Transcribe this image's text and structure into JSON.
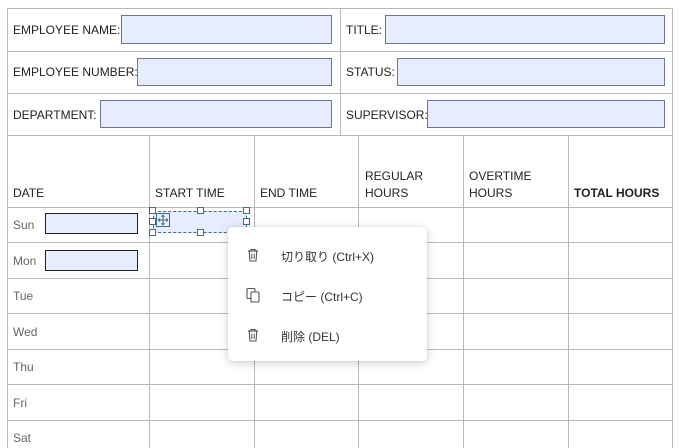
{
  "form": {
    "employee_name_label": "EMPLOYEE NAME:",
    "title_label": "TITLE:",
    "employee_number_label": "EMPLOYEE NUMBER:",
    "status_label": "STATUS:",
    "department_label": "DEPARTMENT:",
    "supervisor_label": "SUPERVISOR:",
    "employee_name_value": "",
    "title_value": "",
    "employee_number_value": "",
    "status_value": "",
    "department_value": "",
    "supervisor_value": ""
  },
  "table": {
    "headers": {
      "date": "DATE",
      "start_time": "START TIME",
      "end_time": "END TIME",
      "regular_hours_1": "REGULAR",
      "regular_hours_2": "HOURS",
      "overtime_hours_1": "OVERTIME",
      "overtime_hours_2": "HOURS",
      "total_hours": "TOTAL HOURS"
    },
    "days": [
      "Sun",
      "Mon",
      "Tue",
      "Wed",
      "Thu",
      "Fri",
      "Sat"
    ]
  },
  "context_menu": {
    "items": [
      {
        "label": "切り取り (Ctrl+X)",
        "icon": "trash-icon"
      },
      {
        "label": "コピー (Ctrl+C)",
        "icon": "copy-icon"
      },
      {
        "label": "削除 (DEL)",
        "icon": "trash-icon"
      }
    ]
  },
  "colors": {
    "field_fill": "#e8ecff",
    "grid_line": "#b9b9b9",
    "selection": "#3f6f7a"
  }
}
